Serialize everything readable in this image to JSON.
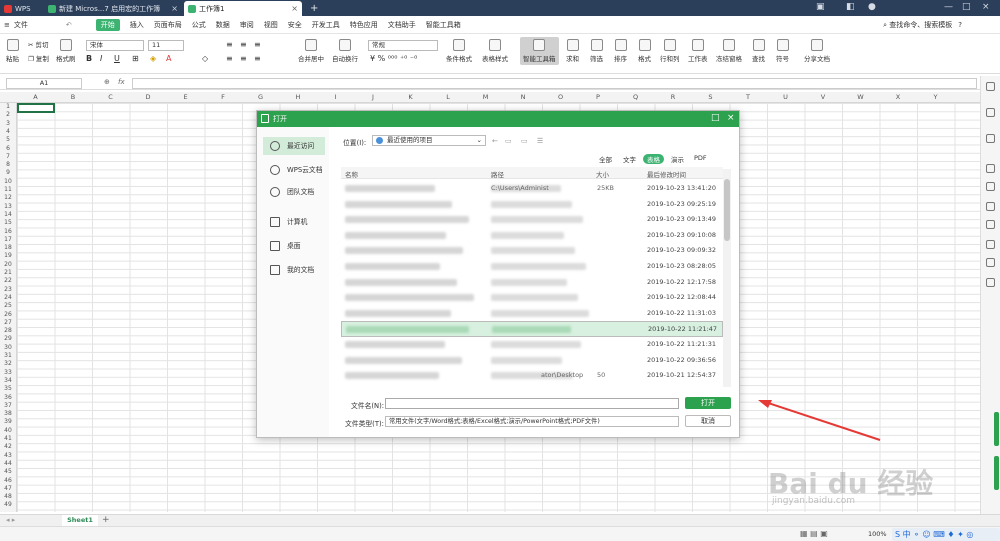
{
  "titlebar": {
    "tabs": [
      {
        "label": "WPS"
      },
      {
        "label": "新建 Micros...7 启用宏的工作簿"
      },
      {
        "label": "工作簿1"
      }
    ],
    "new_tab": "+"
  },
  "menus": [
    "文件",
    "开始",
    "插入",
    "页面布局",
    "公式",
    "数据",
    "审阅",
    "视图",
    "安全",
    "开发工具",
    "特色应用",
    "文档助手",
    "智能工具箱"
  ],
  "search_placeholder": "查找命令、搜索模板",
  "toolbar": {
    "paste": "粘贴",
    "cut": "剪切",
    "copy": "复制",
    "format_painter": "格式刷",
    "font": "宋体",
    "font_size": "11",
    "merge": "合并居中",
    "wrap": "自动换行",
    "number_format": "常规",
    "cond_format": "条件格式",
    "table_style": "表格样式",
    "smart_toolbox": "智能工具箱",
    "sum": "求和",
    "filter": "筛选",
    "sort": "排序",
    "format": "格式",
    "row_col": "行和列",
    "worksheet": "工作表",
    "freeze": "冻结窗格",
    "find": "查找",
    "symbol": "符号",
    "share": "分享文档"
  },
  "formula_bar": {
    "cell": "A1",
    "fx": "fx"
  },
  "columns": [
    "A",
    "B",
    "C",
    "D",
    "E",
    "F",
    "G",
    "H",
    "I",
    "J",
    "K",
    "L",
    "M",
    "N",
    "O",
    "P",
    "Q",
    "R",
    "S",
    "T",
    "U",
    "V",
    "W",
    "X",
    "Y"
  ],
  "rows": [
    "1",
    "2",
    "3",
    "4",
    "5",
    "6",
    "7",
    "8",
    "9",
    "10",
    "11",
    "12",
    "13",
    "14",
    "15",
    "16",
    "17",
    "18",
    "19",
    "20",
    "21",
    "22",
    "23",
    "24",
    "25",
    "26",
    "27",
    "28",
    "29",
    "30",
    "31",
    "32",
    "33",
    "34",
    "35",
    "36",
    "37",
    "38",
    "39",
    "40",
    "41",
    "42",
    "43",
    "44",
    "45",
    "46",
    "47",
    "48",
    "49"
  ],
  "sheet_tab": "Sheet1",
  "add_sheet": "+",
  "zoom": "100%",
  "dialog": {
    "title": "打开",
    "sidebar": [
      "最近访问",
      "WPS云文档",
      "团队文档",
      "计算机",
      "桌面",
      "我的文档"
    ],
    "location_label": "位置(I):",
    "location_value": "最近使用的项目",
    "filters": [
      "全部",
      "文字",
      "表格",
      "演示",
      "PDF"
    ],
    "headers": {
      "name": "名称",
      "path": "路径",
      "size": "大小",
      "date": "最后修改时间"
    },
    "files": [
      {
        "path": "C:\\Users\\Administ",
        "size": "25KB",
        "date": "2019-10-23 13:41:20"
      },
      {
        "path": "",
        "size": "",
        "date": "2019-10-23 09:25:19"
      },
      {
        "path": "",
        "size": "",
        "date": "2019-10-23 09:13:49"
      },
      {
        "path": "",
        "size": "",
        "date": "2019-10-23 09:10:08"
      },
      {
        "path": "",
        "size": "",
        "date": "2019-10-23 09:09:32"
      },
      {
        "path": "",
        "size": "",
        "date": "2019-10-23 08:28:05"
      },
      {
        "path": "",
        "size": "",
        "date": "2019-10-22 12:17:58"
      },
      {
        "path": "",
        "size": "",
        "date": "2019-10-22 12:08:44"
      },
      {
        "path": "",
        "size": "",
        "date": "2019-10-22 11:31:03"
      },
      {
        "path": "",
        "size": "",
        "date": "2019-10-22 11:21:47"
      },
      {
        "path": "",
        "size": "",
        "date": "2019-10-22 11:21:31"
      },
      {
        "path": "",
        "size": "",
        "date": "2019-10-22 09:36:56"
      },
      {
        "path": "ator\\Desktop",
        "size": "50",
        "date": "2019-10-21 12:54:37"
      }
    ],
    "filename_label": "文件名(N):",
    "filename_value": "",
    "filetype_label": "文件类型(T):",
    "filetype_value": "常用文件(文字/Word格式;表格/Excel格式;演示/PowerPoint格式;PDF文件)",
    "open_button": "打开",
    "cancel_button": "取消"
  },
  "watermark": {
    "brand": "Bai du 经验",
    "url": "jingyan.baidu.com"
  },
  "colors": {
    "accent": "#2ca14e",
    "titlebar": "#2c3f5a",
    "arrow": "#e53935"
  }
}
